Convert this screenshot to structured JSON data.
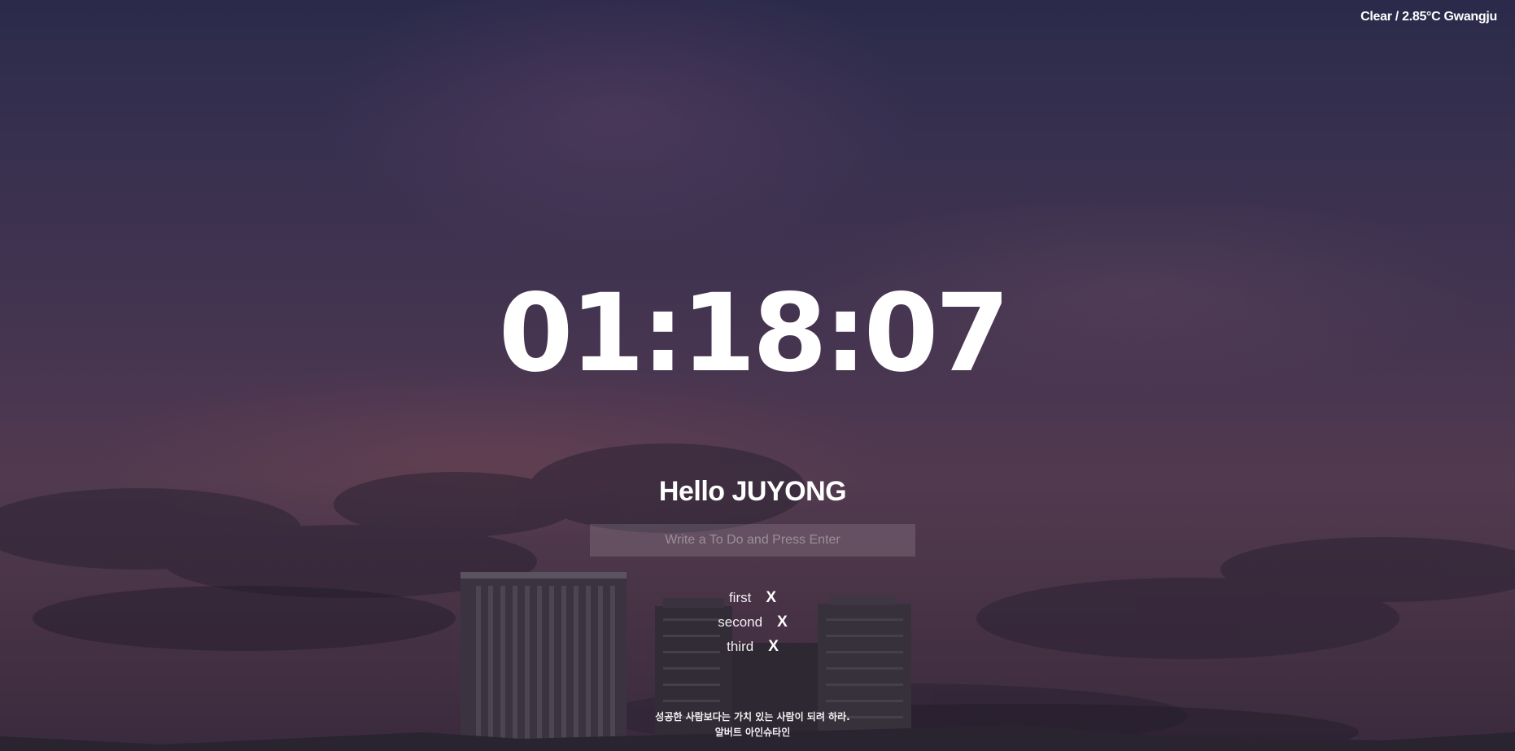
{
  "weather": {
    "text": "Clear / 2.85°C Gwangju"
  },
  "clock": {
    "time": "01:18:07"
  },
  "greeting": {
    "text": "Hello JUYONG"
  },
  "todo": {
    "placeholder": "Write a To Do and Press Enter",
    "value": "",
    "items": [
      {
        "text": "first",
        "delete_label": "X"
      },
      {
        "text": "second",
        "delete_label": "X"
      },
      {
        "text": "third",
        "delete_label": "X"
      }
    ]
  },
  "quote": {
    "text": "성공한 사람보다는 가치 있는 사람이 되려 하라.",
    "author": "알버트 아인슈타인"
  }
}
